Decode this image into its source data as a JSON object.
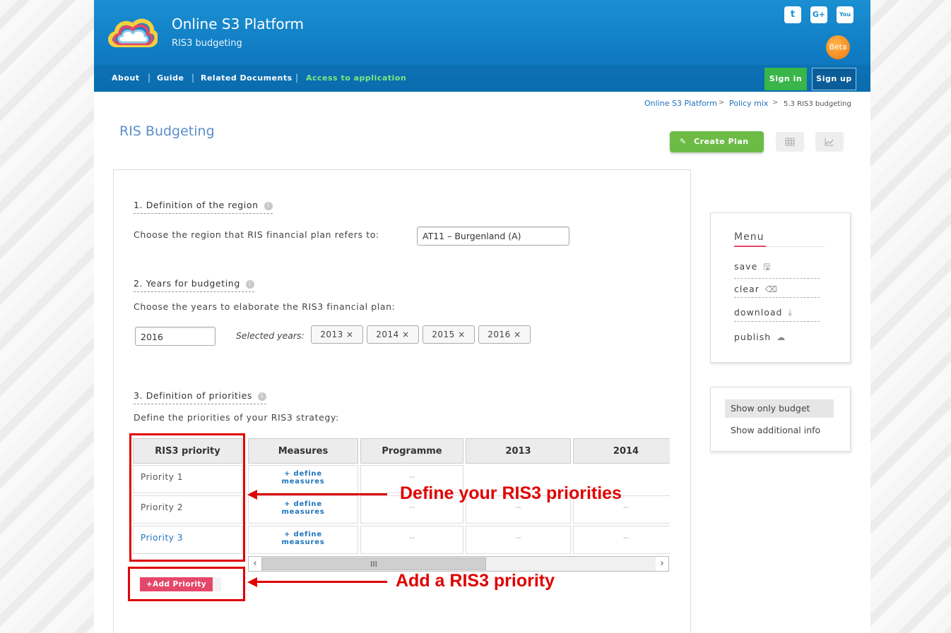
{
  "header": {
    "title": "Online S3 Platform",
    "subtitle": "RIS3 budgeting",
    "beta": "Beta",
    "social": [
      {
        "name": "twitter",
        "glyph": "t"
      },
      {
        "name": "google-plus",
        "glyph": "G+"
      },
      {
        "name": "youtube",
        "glyph": "You"
      }
    ]
  },
  "nav": {
    "items": [
      "About",
      "Guide",
      "Related Documents",
      "Access to application"
    ],
    "sign_in": "Sign in",
    "sign_up": "Sign up"
  },
  "breadcrumb": [
    "Online S3 Platform",
    "Policy mix",
    "5.3 RIS3 budgeting"
  ],
  "page_title": "RIS Budgeting",
  "toolbar": {
    "create_plan": "Create Plan",
    "create_icon": "✎"
  },
  "section1": {
    "title": "1. Definition of the region",
    "text": "Choose the region that RIS financial plan refers to:",
    "region_value": "AT11 – Burgenland (A)"
  },
  "section2": {
    "title": "2. Years for budgeting",
    "text": "Choose the years to elaborate the RIS3 financial plan:",
    "year_input": "2016",
    "selected_label": "Selected years:",
    "years": [
      "2013 ×",
      "2014 ×",
      "2015 ×",
      "2016 ×"
    ]
  },
  "section3": {
    "title": "3. Definition of priorities",
    "text": "Define the priorities of your RIS3 strategy:",
    "columns": [
      "RIS3 priority",
      "Measures",
      "Programme",
      "2013",
      "2014"
    ],
    "rows": [
      {
        "priority": "Priority 1",
        "measure_1": "+ define",
        "measure_2": "measures",
        "programme": "--",
        "y2013": "",
        "y2014": ""
      },
      {
        "priority": "Priority 2",
        "measure_1": "+ define",
        "measure_2": "measures",
        "programme": "--",
        "y2013": "--",
        "y2014": "--"
      },
      {
        "priority": "Priority 3",
        "measure_1": "+ define",
        "measure_2": "measures",
        "programme": "--",
        "y2013": "--",
        "y2014": "--"
      }
    ],
    "scroll_thumb": "III",
    "add_button": "+Add Priority"
  },
  "menu": {
    "title": "Menu",
    "items": [
      {
        "label": "save",
        "icon": "save-icon",
        "glyph": "🖫"
      },
      {
        "label": "clear",
        "icon": "eraser-icon",
        "glyph": "⌫"
      },
      {
        "label": "download",
        "icon": "download-icon",
        "glyph": "⤓"
      },
      {
        "label": "publish",
        "icon": "cloud-upload-icon",
        "glyph": "☁"
      }
    ]
  },
  "view_options": [
    "Show only budget",
    "Show additional info"
  ],
  "annotations": {
    "define": "Define your RIS3 priorities",
    "add": "Add a RIS3 priority"
  },
  "colors": {
    "header_blue": "#0f7bc2",
    "accent_green": "#6cbb45",
    "accent_pink": "#e5476a",
    "annotation_red": "#e00000"
  }
}
